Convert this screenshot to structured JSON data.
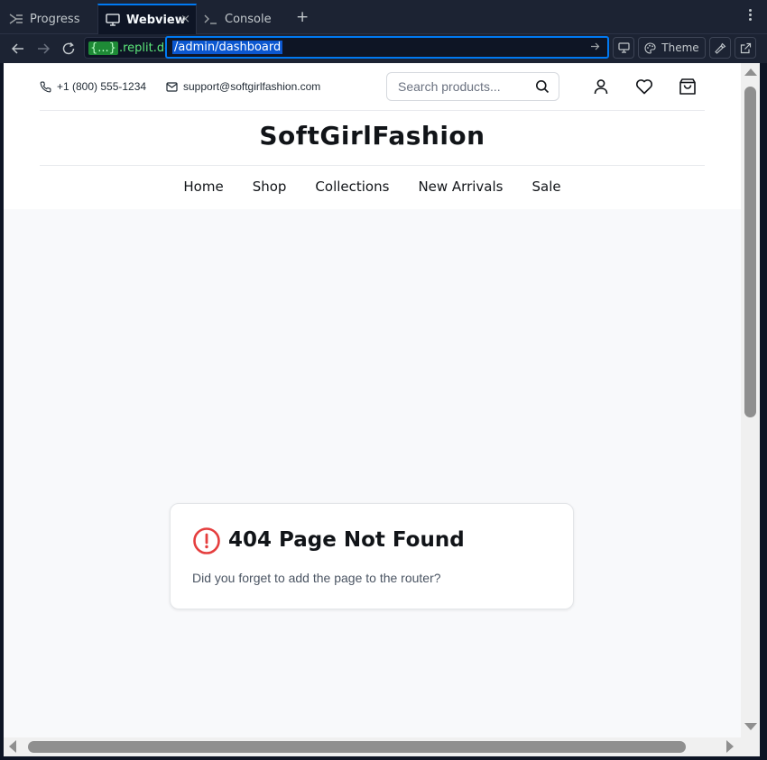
{
  "ide": {
    "tabs": [
      {
        "label": "Progress",
        "icon": "progress-icon"
      },
      {
        "label": "Webview",
        "icon": "monitor-icon",
        "active": true
      },
      {
        "label": "Console",
        "icon": "terminal-icon"
      }
    ],
    "close_glyph": "×",
    "add_glyph": "+"
  },
  "urlbar": {
    "host_badge": "{...}",
    "host": ".replit.dev",
    "path": "/admin/dashboard",
    "theme_label": "Theme"
  },
  "site": {
    "phone": "+1 (800) 555-1234",
    "email": "support@softgirlfashion.com",
    "search_placeholder": "Search products...",
    "brand": "SoftGirlFashion",
    "nav": [
      "Home",
      "Shop",
      "Collections",
      "New Arrivals",
      "Sale"
    ]
  },
  "error": {
    "title": "404 Page Not Found",
    "message": "Did you forget to add the page to the router?",
    "icon_color": "#e53e3e"
  },
  "colors": {
    "accent": "#0079f2",
    "host_green": "#5ce87a",
    "ide_bg": "#1c2333"
  }
}
